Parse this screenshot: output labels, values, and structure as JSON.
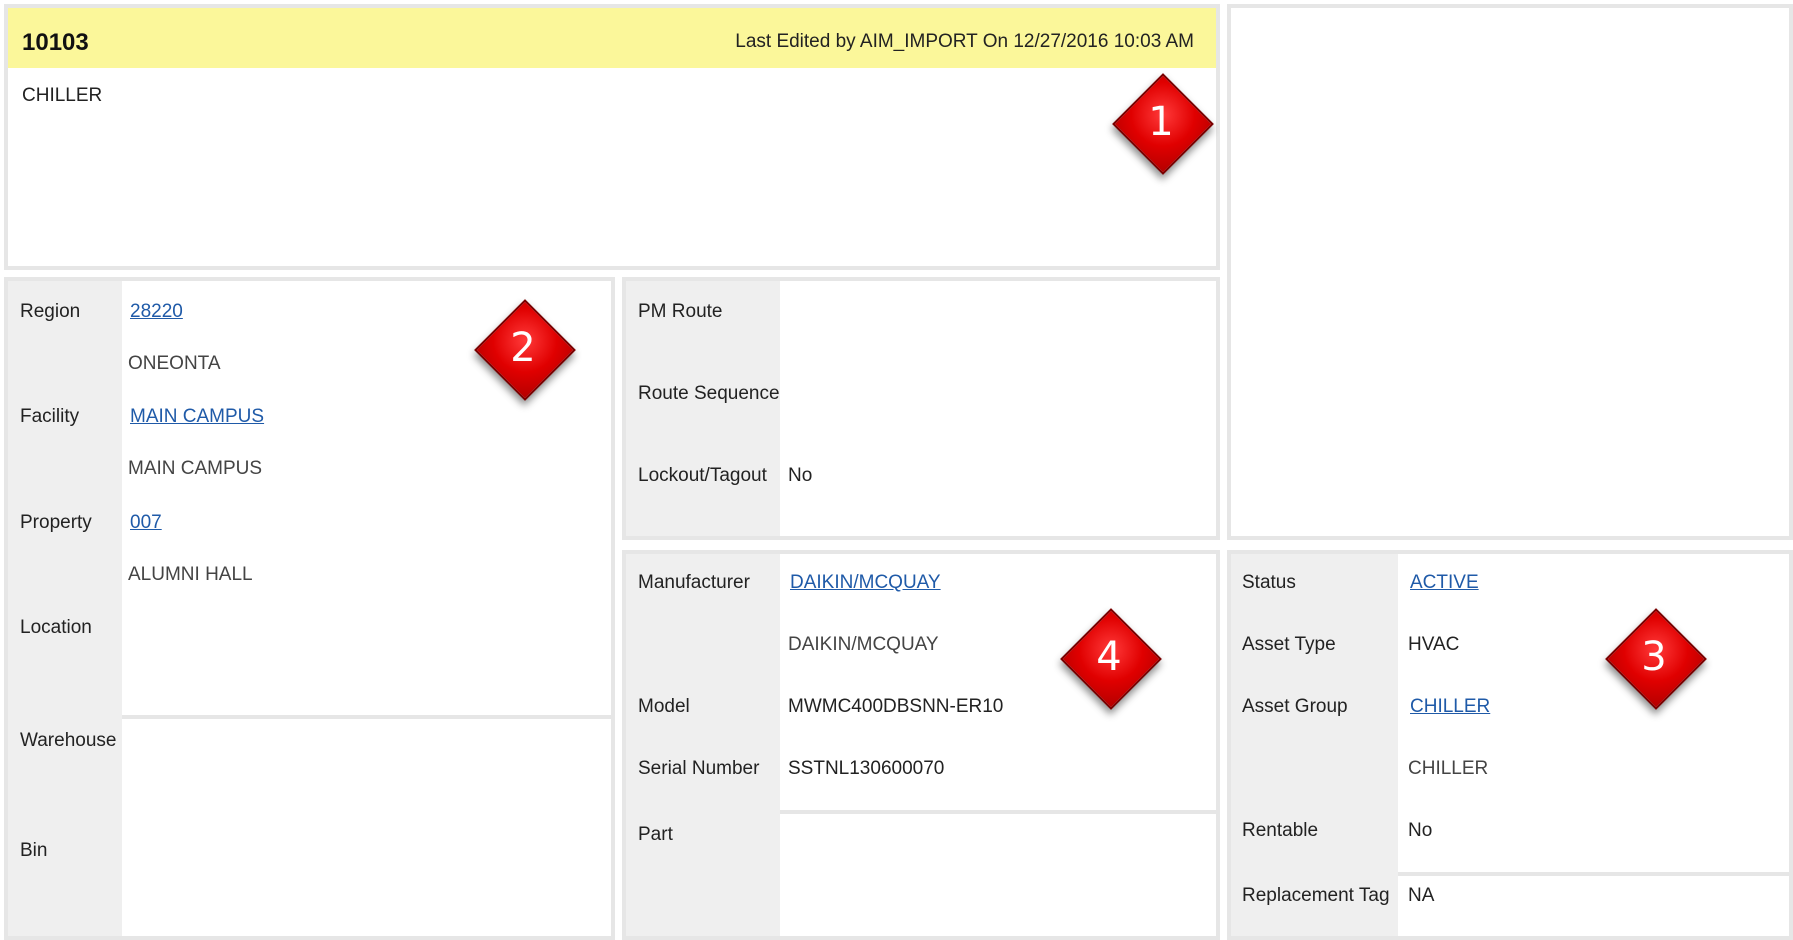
{
  "header": {
    "asset_id": "10103",
    "last_edited": "Last Edited by AIM_IMPORT On 12/27/2016 10:03 AM",
    "description": "CHILLER"
  },
  "location_panel": {
    "region_label": "Region",
    "region_code": "28220",
    "region_name": "ONEONTA",
    "facility_label": "Facility",
    "facility_code": "MAIN CAMPUS",
    "facility_name": "MAIN CAMPUS",
    "property_label": "Property",
    "property_code": "007",
    "property_name": "ALUMNI HALL",
    "location_label": "Location",
    "warehouse_label": "Warehouse",
    "bin_label": "Bin"
  },
  "route_panel": {
    "pm_route_label": "PM Route",
    "route_sequence_label": "Route Sequence",
    "lockout_label": "Lockout/Tagout",
    "lockout_value": "No"
  },
  "manufacturer_panel": {
    "manufacturer_label": "Manufacturer",
    "manufacturer_code": "DAIKIN/MCQUAY",
    "manufacturer_name": "DAIKIN/MCQUAY",
    "model_label": "Model",
    "model_value": "MWMC400DBSNN-ER10",
    "serial_label": "Serial Number",
    "serial_value": "SSTNL130600070",
    "part_label": "Part"
  },
  "status_panel": {
    "status_label": "Status",
    "status_value": "ACTIVE",
    "asset_type_label": "Asset Type",
    "asset_type_value": "HVAC",
    "asset_group_label": "Asset Group",
    "asset_group_code": "CHILLER",
    "asset_group_name": "CHILLER",
    "rentable_label": "Rentable",
    "rentable_value": "No",
    "replacement_tag_label": "Replacement Tag",
    "replacement_tag_value": "NA"
  },
  "callouts": [
    "1",
    "2",
    "3",
    "4"
  ],
  "colors": {
    "header_bg": "#fbf79a",
    "link": "#1f5aa8",
    "callout_red": "#e00000",
    "label_column_bg": "#efefef",
    "panel_border": "#e6e6e6"
  }
}
